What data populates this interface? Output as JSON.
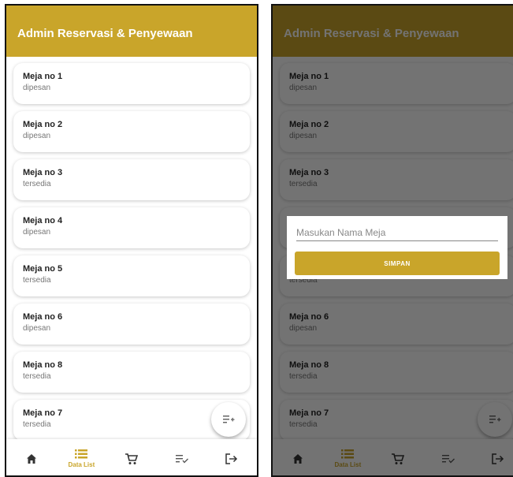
{
  "app": {
    "title": "Admin Reservasi & Penyewaan"
  },
  "colors": {
    "accent": "#c9a52a"
  },
  "tables": [
    {
      "name": "Meja no 1",
      "status": "dipesan"
    },
    {
      "name": "Meja no 2",
      "status": "dipesan"
    },
    {
      "name": "Meja no 3",
      "status": "tersedia"
    },
    {
      "name": "Meja no 4",
      "status": "dipesan"
    },
    {
      "name": "Meja no 5",
      "status": "tersedia"
    },
    {
      "name": "Meja no 6",
      "status": "dipesan"
    },
    {
      "name": "Meja no 8",
      "status": "tersedia"
    },
    {
      "name": "Meja no 7",
      "status": "tersedia"
    }
  ],
  "fab": {
    "icon": "playlist-add-icon"
  },
  "nav": {
    "items": [
      {
        "icon": "home-icon"
      },
      {
        "icon": "list-icon",
        "label": "Data List",
        "active": true
      },
      {
        "icon": "cart-icon"
      },
      {
        "icon": "playlist-check-icon"
      },
      {
        "icon": "logout-icon"
      }
    ]
  },
  "dialog": {
    "placeholder": "Masukan Nama Meja",
    "button_label": "SIMPAN"
  }
}
